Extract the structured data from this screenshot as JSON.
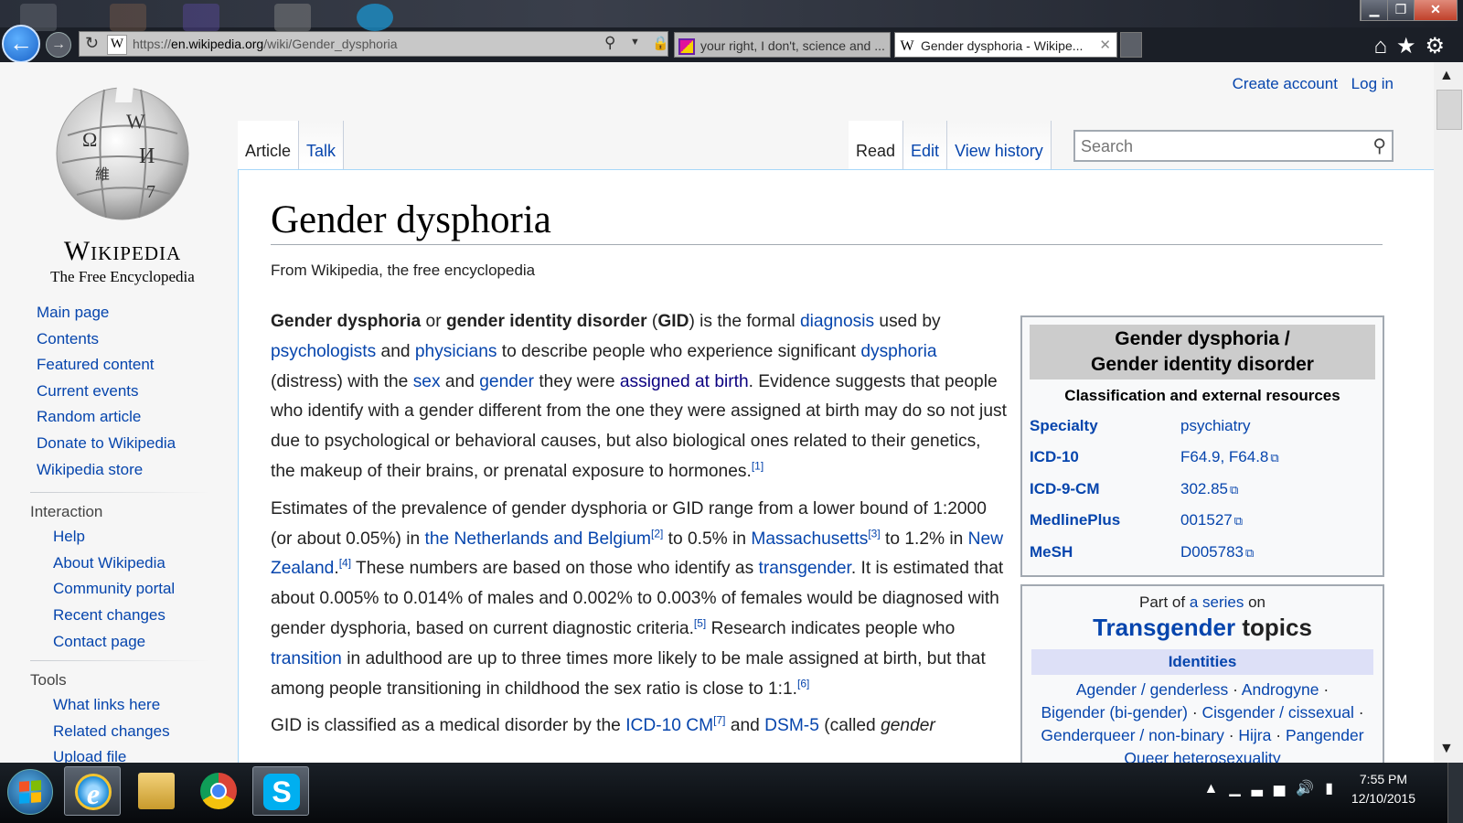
{
  "browser": {
    "url_prefix": "https://",
    "url_host": "en.wikipedia.org",
    "url_path": "/wiki/Gender_dysphoria",
    "tabs": [
      {
        "title": "your right, I don't, science and ..."
      },
      {
        "title": "Gender dysphoria - Wikipe..."
      }
    ],
    "window_controls": {
      "minimize": "▁",
      "restore": "❐",
      "close": "✕"
    }
  },
  "wiki": {
    "wordmark": "Wikipedia",
    "tagline": "The Free Encyclopedia",
    "user_links": {
      "create": "Create account",
      "login": "Log in"
    },
    "tabs_left": [
      "Article",
      "Talk"
    ],
    "tabs_right": [
      "Read",
      "Edit",
      "View history"
    ],
    "search_placeholder": "Search",
    "sidebar": {
      "main": [
        "Main page",
        "Contents",
        "Featured content",
        "Current events",
        "Random article",
        "Donate to Wikipedia",
        "Wikipedia store"
      ],
      "interaction_heading": "Interaction",
      "interaction": [
        "Help",
        "About Wikipedia",
        "Community portal",
        "Recent changes",
        "Contact page"
      ],
      "tools_heading": "Tools",
      "tools": [
        "What links here",
        "Related changes",
        "Upload file"
      ]
    }
  },
  "article": {
    "title": "Gender dysphoria",
    "site_sub": "From Wikipedia, the free encyclopedia",
    "p1": {
      "b1": "Gender dysphoria",
      "t1": " or ",
      "b2": "gender identity disorder",
      "t2": " (",
      "b3": "GID",
      "t3": ") is the formal ",
      "l1": "diagnosis",
      "t4": " used by ",
      "l2": "psychologists",
      "t5": " and ",
      "l3": "physicians",
      "t6": " to describe people who experience significant ",
      "l4": "dysphoria",
      "t7": " (distress) with the ",
      "l5": "sex",
      "t8": " and ",
      "l6": "gender",
      "t9": " they were ",
      "l7": "assigned at birth",
      "t10": ". Evidence suggests that people who identify with a gender different from the one they were assigned at birth may do so not just due to psychological or behavioral causes, but also biological ones related to their genetics, the makeup of their brains, or prenatal exposure to hormones.",
      "r1": "[1]"
    },
    "p2": {
      "t1": "Estimates of the prevalence of gender dysphoria or GID range from a lower bound of 1:2000 (or about 0.05%) in ",
      "l1": "the Netherlands and Belgium",
      "r2": "[2]",
      "t2": " to 0.5% in ",
      "l2": "Massachusetts",
      "r3": "[3]",
      "t3": " to 1.2% in ",
      "l3": "New Zealand",
      "t3b": ".",
      "r4": "[4]",
      "t4": " These numbers are based on those who identify as ",
      "l4": "transgender",
      "t5": ". It is estimated that about 0.005% to 0.014% of males and 0.002% to 0.003% of females would be diagnosed with gender dysphoria, based on current diagnostic criteria.",
      "r5": "[5]",
      "t6": " Research indicates people who ",
      "l5": "transition",
      "t7": " in adulthood are up to three times more likely to be male assigned at birth, but that among people transitioning in childhood the sex ratio is close to 1:1.",
      "r6": "[6]"
    },
    "p3": {
      "t1": "GID is classified as a medical disorder by the ",
      "l1": "ICD-10 CM",
      "r7": "[7]",
      "t2": " and ",
      "l2": "DSM-5",
      "t3": " (called ",
      "i1": "gender"
    }
  },
  "infobox": {
    "title_line1": "Gender dysphoria /",
    "title_line2": "Gender identity disorder",
    "subheader": "Classification and external resources",
    "rows": [
      {
        "key": "Specialty",
        "value": "psychiatry",
        "ext": ""
      },
      {
        "key": "ICD-10",
        "value": "F64.9, F64.8",
        "ext": "⧉"
      },
      {
        "key": "ICD-9-CM",
        "value": "302.85",
        "ext": "⧉"
      },
      {
        "key": "MedlinePlus",
        "value": "001527",
        "ext": "⧉"
      },
      {
        "key": "MeSH",
        "value": "D005783",
        "ext": "⧉"
      }
    ]
  },
  "series_box": {
    "part_of": "Part of ",
    "a_series": "a series",
    "on": " on",
    "topic": "Transgender",
    "topics": " topics",
    "band": "Identities",
    "links": [
      "Agender / genderless",
      "Androgyne",
      "Bigender (bi-gender)",
      "Cisgender / cissexual",
      "Genderqueer / non-binary",
      "Hijra",
      "Pangender",
      "Queer heterosexuality"
    ]
  },
  "taskbar": {
    "time": "7:55 PM",
    "date": "12/10/2015",
    "tray_icons": [
      "show-hidden-icon",
      "signal-icon",
      "volume-icon",
      "battery-icon"
    ]
  }
}
